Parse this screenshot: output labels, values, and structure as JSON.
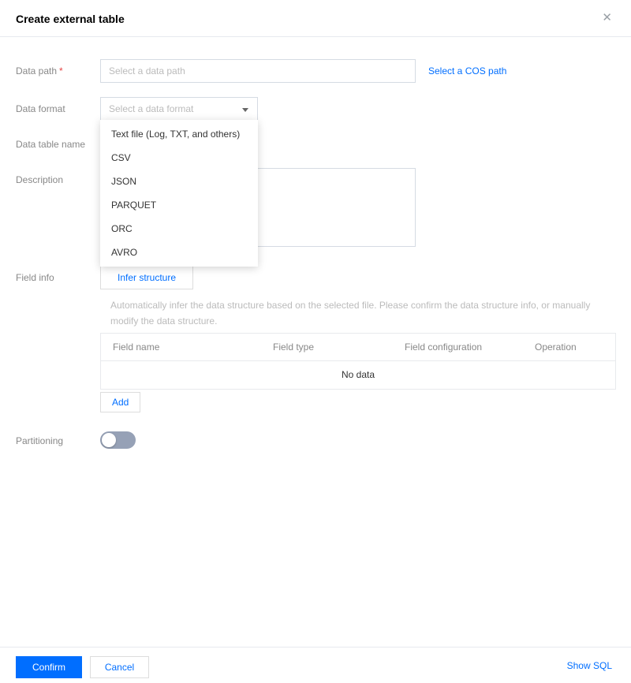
{
  "dialog": {
    "title": "Create external table",
    "close_icon": "✕"
  },
  "colors": {
    "accent": "#006eff",
    "toggle_off": "#96a1b6",
    "required": "#e54545"
  },
  "form": {
    "data_path": {
      "label": "Data path",
      "required_mark": "*",
      "placeholder": "Select a data path",
      "value": "",
      "cos_link": "Select a COS path"
    },
    "data_format": {
      "label": "Data format",
      "placeholder": "Select a data format",
      "selected": "",
      "options": [
        "Text file (Log, TXT, and others)",
        "CSV",
        "JSON",
        "PARQUET",
        "ORC",
        "AVRO"
      ]
    },
    "data_table_name": {
      "label": "Data table name",
      "value": ""
    },
    "description": {
      "label": "Description",
      "value": ""
    },
    "field_info": {
      "label": "Field info",
      "infer_button": "Infer structure",
      "help_text": "Automatically infer the data structure based on the selected file. Please confirm the data structure info, or manually modify the data structure.",
      "table": {
        "columns": [
          "Field name",
          "Field type",
          "Field configuration",
          "Operation"
        ],
        "empty_text": "No data"
      },
      "add_button": "Add"
    },
    "partitioning": {
      "label": "Partitioning",
      "enabled": false
    }
  },
  "footer": {
    "confirm": "Confirm",
    "cancel": "Cancel",
    "show_sql": "Show SQL"
  }
}
